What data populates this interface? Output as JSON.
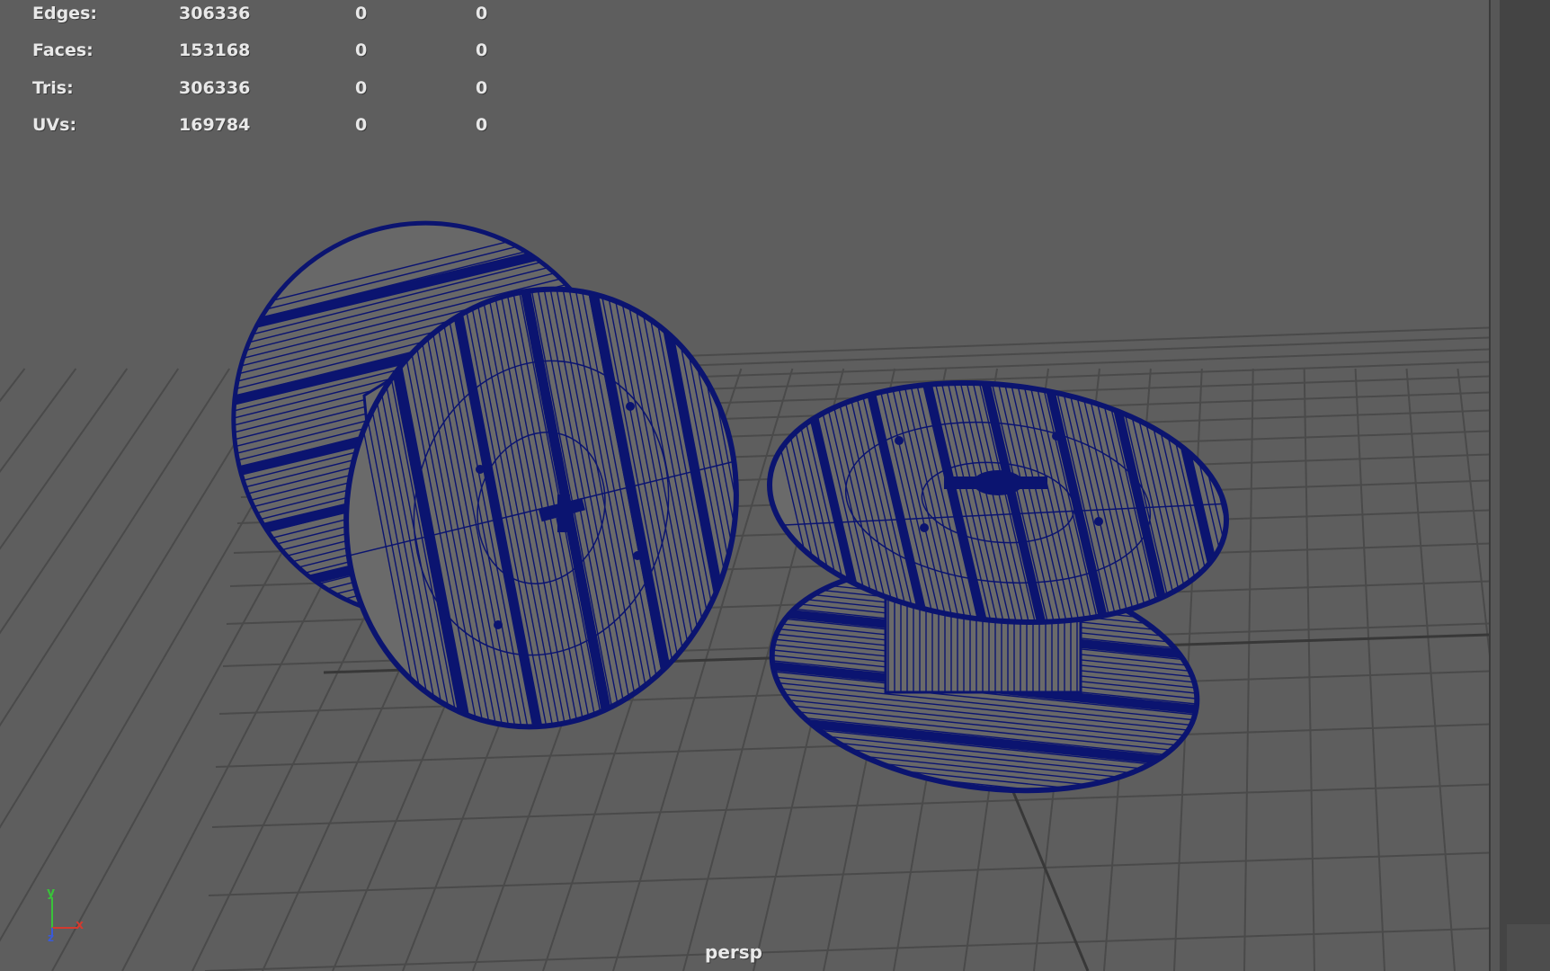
{
  "hud": {
    "rows": [
      {
        "label": "Edges:",
        "v1": "306336",
        "v2": "0",
        "v3": "0"
      },
      {
        "label": "Faces:",
        "v1": "153168",
        "v2": "0",
        "v3": "0"
      },
      {
        "label": "Tris:",
        "v1": "306336",
        "v2": "0",
        "v3": "0"
      },
      {
        "label": "UVs:",
        "v1": "169784",
        "v2": "0",
        "v3": "0"
      }
    ]
  },
  "camera": {
    "label": "persp"
  },
  "axis": {
    "y": "y",
    "x": "x",
    "z": "z"
  },
  "colors": {
    "viewport_bg": "#5e5e5e",
    "grid": "#4a4a4a",
    "wireframe": "#0b1470",
    "hud_text": "#e8e8e8",
    "axis_x": "#d33a2e",
    "axis_y": "#39c23a",
    "axis_z": "#3a5ad8"
  },
  "objects": [
    "cable-spool-left",
    "cable-spool-right"
  ]
}
